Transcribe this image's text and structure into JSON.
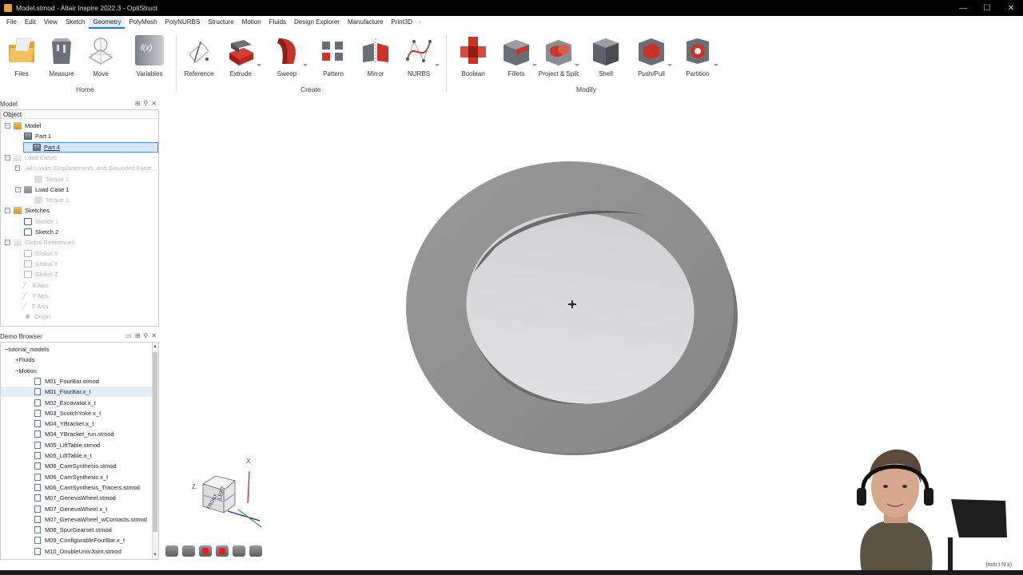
{
  "window": {
    "title": "Model.stmod - Altair Inspire 2022.3 - OptiStruct",
    "controls": [
      "—",
      "☐",
      "✕"
    ]
  },
  "menu": {
    "items": [
      "File",
      "Edit",
      "View",
      "Sketch",
      "Geometry",
      "PolyMesh",
      "PolyNURBS",
      "Structure",
      "Motion",
      "Fluids",
      "Design Explorer",
      "Manufacture",
      "Print3D"
    ],
    "active": "Geometry",
    "add_symbol": "+"
  },
  "ribbon": {
    "groups": [
      "Home",
      "Create",
      "Modify"
    ],
    "tools": {
      "files": "Files",
      "measure": "Measure",
      "move": "Move",
      "variables": "Variables",
      "variables_glyph": "f(x)",
      "reference": "Reference",
      "extrude": "Extrude",
      "sweep": "Sweep",
      "pattern": "Pattern",
      "mirror": "Mirror",
      "nurbs": "NURBS",
      "boolean": "Boolean",
      "fillets": "Fillets",
      "project_split": "Project & Split",
      "shell": "Shell",
      "push_pull": "Push/Pull",
      "partition": "Partition"
    }
  },
  "model_panel": {
    "title": "Model",
    "column": "Object",
    "tree": [
      {
        "label": "Model",
        "icon": "folder",
        "level": 1,
        "expander": "−"
      },
      {
        "label": "Part 1",
        "icon": "part",
        "level": 2
      },
      {
        "label": "Part 4",
        "icon": "part",
        "level": 2,
        "selected": true
      },
      {
        "label": "Load Cases",
        "icon": "folder",
        "level": 1,
        "dim": true,
        "expander": "−"
      },
      {
        "label": "All Loads, Displacements, and Grounded Faste...",
        "icon": "load",
        "level": 2,
        "dim": true,
        "expander": "−"
      },
      {
        "label": "Torque 1",
        "icon": "load",
        "level": 3,
        "dim": true
      },
      {
        "label": "Load Case 1",
        "icon": "load",
        "level": 2,
        "expander": "−"
      },
      {
        "label": "Torque 1",
        "icon": "load",
        "level": 3,
        "dim": true
      },
      {
        "label": "Sketches",
        "icon": "folder",
        "level": 1,
        "expander": "−"
      },
      {
        "label": "Sketch 1",
        "icon": "sketch",
        "level": 2,
        "dim": true
      },
      {
        "label": "Sketch 2",
        "icon": "sketch",
        "level": 2
      },
      {
        "label": "Global References",
        "icon": "folder",
        "level": 1,
        "dim": true,
        "expander": "−"
      },
      {
        "label": "Global X",
        "icon": "ref",
        "level": 2,
        "dim": true
      },
      {
        "label": "Global Y",
        "icon": "ref",
        "level": 2,
        "dim": true
      },
      {
        "label": "Global Z",
        "icon": "ref",
        "level": 2,
        "dim": true
      },
      {
        "label": "X Axis",
        "icon": "axis",
        "level": 2,
        "dim": true
      },
      {
        "label": "Y Axis",
        "icon": "axis",
        "level": 2,
        "dim": true
      },
      {
        "label": "Z Axis",
        "icon": "axis",
        "level": 2,
        "dim": true
      },
      {
        "label": "Origin",
        "icon": "dot",
        "level": 2,
        "dim": true
      }
    ]
  },
  "demo_browser": {
    "title": "Demo Browser",
    "tree": [
      {
        "label": "tutorial_models",
        "icon": "folder",
        "level": 1,
        "expander": "−"
      },
      {
        "label": "Fluids",
        "icon": "folder",
        "level": 2,
        "expander": "+"
      },
      {
        "label": "Motion",
        "icon": "folder",
        "level": 2,
        "expander": "−"
      },
      {
        "label": "M01_FourBar.stmod",
        "icon": "file",
        "level": 3
      },
      {
        "label": "M01_FourBar.x_t",
        "icon": "file",
        "level": 3,
        "highlight": true
      },
      {
        "label": "M02_Excavator.x_t",
        "icon": "file",
        "level": 3
      },
      {
        "label": "M03_ScotchYoke.x_t",
        "icon": "file",
        "level": 3
      },
      {
        "label": "M04_YBracket.x_t",
        "icon": "file",
        "level": 3
      },
      {
        "label": "M04_YBracket_run.stmod",
        "icon": "file",
        "level": 3
      },
      {
        "label": "M05_LiftTable.stmod",
        "icon": "file",
        "level": 3
      },
      {
        "label": "M05_LiftTable.x_t",
        "icon": "file",
        "level": 3
      },
      {
        "label": "M06_CamSynthesis.stmod",
        "icon": "file",
        "level": 3
      },
      {
        "label": "M06_CamSynthesis.x_t",
        "icon": "file",
        "level": 3
      },
      {
        "label": "M06_CamSynthesis_Tracers.stmod",
        "icon": "file",
        "level": 3
      },
      {
        "label": "M07_GenevaWheel.stmod",
        "icon": "file",
        "level": 3
      },
      {
        "label": "M07_GenevaWheel.x_t",
        "icon": "file",
        "level": 3
      },
      {
        "label": "M07_GenevaWheel_wContacts.stmod",
        "icon": "file",
        "level": 3
      },
      {
        "label": "M08_SpurGearset.stmod",
        "icon": "file",
        "level": 3
      },
      {
        "label": "M09_ConfigurableFourBar.x_t",
        "icon": "file",
        "level": 3
      },
      {
        "label": "M10_DoubleUnivJoint.stmod",
        "icon": "file",
        "level": 3
      }
    ]
  },
  "viewcube": {
    "axis_x": "X",
    "axis_z": "Z",
    "face_left": "LEFT",
    "face_front": "FRONT"
  },
  "status": {
    "units": "(mm t N s)"
  },
  "colors": {
    "accent": "#2a74c4",
    "selection": "#d6e6f8",
    "part_outer": "#8d8d8d",
    "part_inner": "#d9d9db"
  }
}
